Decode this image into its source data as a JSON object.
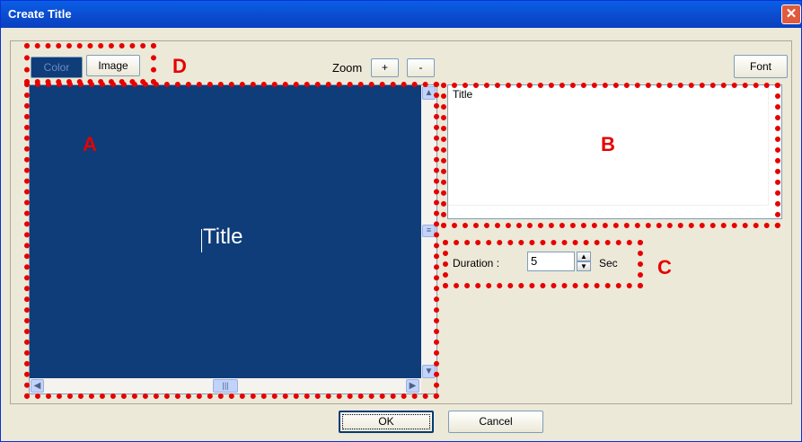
{
  "window": {
    "title": "Create Title",
    "close_symbol": "✕"
  },
  "toolbar": {
    "color_label": "Color",
    "image_label": "Image",
    "zoom_label": "Zoom",
    "zoom_in_label": "+",
    "zoom_out_label": "-",
    "font_label": "Font"
  },
  "preview": {
    "title_text": "Title",
    "background_color": "#0e3d7a"
  },
  "text_editor": {
    "value": "Title"
  },
  "duration": {
    "label": "Duration :",
    "value": "5",
    "unit": "Sec"
  },
  "footer": {
    "ok_label": "OK",
    "cancel_label": "Cancel"
  },
  "annotations": {
    "a": "A",
    "b": "B",
    "c": "C",
    "d": "D"
  }
}
